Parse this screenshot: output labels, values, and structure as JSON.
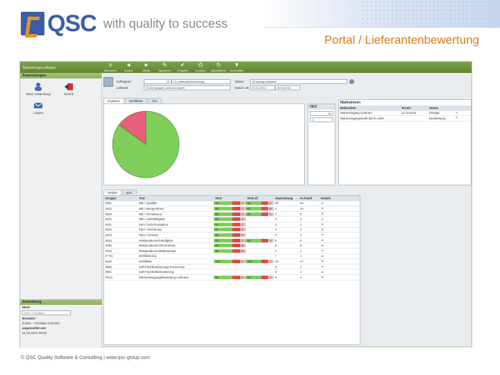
{
  "slide": {
    "logo_text": "QSC",
    "tagline": "with quality to success",
    "title": "Portal / Lieferantenbewertung",
    "footer": "© QSC Quality Software & Consulting | www.qsc-group.com"
  },
  "app": {
    "breadcrumb": "Bewertungen pflegen",
    "toolbar": [
      {
        "label": "Abbrechen",
        "icon": "x"
      },
      {
        "label": "Zurück",
        "icon": "◄"
      },
      {
        "label": "Weiter",
        "icon": "►"
      },
      {
        "label": "Speichern",
        "icon": "✎"
      },
      {
        "label": "Freigabe",
        "icon": "✔"
      },
      {
        "label": "Drucken",
        "icon": "⎙"
      },
      {
        "label": "Aktualisieren",
        "icon": "↻"
      },
      {
        "label": "Normalfilter",
        "icon": "▼"
      }
    ],
    "sidebar": {
      "header": "Anwendungen",
      "icons": [
        "Neue Anwendung",
        "Zurück",
        "Logout"
      ],
      "bottom_header": "Anmeldung",
      "werk_label": "Werk",
      "werk_value": "Werk 1 Stuttgart",
      "benutzer_label": "Benutzer",
      "benutzer_value": "Gobec - Christian Schmetz",
      "angemeldet_label": "angemeldet seit",
      "angemeldet_value": "21.10.2014 09:15"
    },
    "form": {
      "auftragsart_label": "Auftragsart",
      "auftragsart_code": "03",
      "auftragsart_value": "L5 Lieferantenbewertung",
      "status_label": "Status",
      "status_value": "30 Auftrag bewertet",
      "lieferant_label": "Lieferant",
      "lieferant_value": "20163 Beispiel Lieferant GmbH",
      "datum_label": "Datum v/b",
      "datum_von": "01.01.2014",
      "datum_bis": "30.06.2014"
    },
    "tabs": [
      "Ergebnis",
      "Zertifikate",
      "Text"
    ],
    "okz_panel": {
      "header": "OKZ",
      "value": "84",
      "grade": "C"
    },
    "massnahmen": {
      "title": "Maßnahmen",
      "headers": [
        "Maßnahme",
        "Termin",
        "Status"
      ],
      "rows": [
        {
          "text": "Wareneingang Lieferant",
          "termin": "14.10.2014",
          "status": "Erledigt"
        },
        {
          "text": "Wareneingangsaudit durch Liefer",
          "termin": "",
          "status": "Bearbeitung"
        }
      ]
    },
    "chart_data": {
      "type": "pie",
      "values": [
        85,
        15
      ],
      "colors": [
        "#7fce59",
        "#e8607a"
      ]
    },
    "grid_tabs": [
      "Details",
      "ppm"
    ],
    "grid_headers": [
      "Gruppe",
      "Text",
      "OKZ",
      "OKZ-zif",
      "Abweichung",
      "%-Anteil",
      "Details"
    ],
    "grid_rows": [
      {
        "g": "IE01",
        "t": "WE / Qualität",
        "okz": "75",
        "k": "C",
        "okzz": "62",
        "kz": "C",
        "abw": "20",
        "pct": "34"
      },
      {
        "g": "IE02",
        "t": "WE / Mengenkreuz",
        "okz": "80",
        "k": "C",
        "okzz": "63",
        "kz": "B",
        "abw": "2",
        "pct": "15"
      },
      {
        "g": "IE03",
        "t": "WE / Termintreue",
        "okz": "95",
        "k": "A",
        "okzz": "95",
        "kz": "A",
        "abw": "7",
        "pct": "3"
      },
      {
        "g": "IE3C",
        "t": "WE / Lieferfähigkeit",
        "okz": "90",
        "k": "A",
        "okzz": "",
        "kz": "",
        "abw": "2",
        "pct": "3"
      },
      {
        "g": "IE31",
        "t": "Ppm / NIO-Produktion",
        "okz": "97",
        "k": "C",
        "okzz": "",
        "kz": "",
        "abw": "1",
        "pct": "1"
      },
      {
        "g": "IE32",
        "t": "Ppm / Zeichnung",
        "okz": "97",
        "k": "C",
        "okzz": "",
        "kz": "",
        "abw": "1",
        "pct": "1"
      },
      {
        "g": "IE33",
        "t": "Ppm / Gesamt",
        "okz": "96",
        "k": "C",
        "okzz": "",
        "kz": "",
        "abw": "3",
        "pct": "1"
      },
      {
        "g": "IE34",
        "t": "Reklamationen/Häufigkeit",
        "okz": "55",
        "k": "C",
        "okzz": "55",
        "kz": "A",
        "abw": "5",
        "pct": "6"
      },
      {
        "g": "IE35",
        "t": "Reklamationen/Termintreue",
        "okz": "50",
        "k": "B",
        "okzz": "",
        "kz": "",
        "abw": "5",
        "pct": "8"
      },
      {
        "g": "IE36",
        "t": "Reklamationen/Wirksamkeit",
        "okz": "50",
        "k": "B",
        "okzz": "",
        "kz": "",
        "abw": "2",
        "pct": "1"
      },
      {
        "g": "F.701",
        "t": "Zertifizierung",
        "okz": "",
        "k": "",
        "okzz": "",
        "kz": "",
        "abw": "/",
        "pct": "1"
      },
      {
        "g": "IE40",
        "t": "Zertifikate",
        "okz": "100",
        "k": "A",
        "okzz": "100",
        "kz": "A",
        "abw": "10",
        "pct": "17"
      },
      {
        "g": "IE50",
        "t": "Soft-Fact/Erweiterungs Know-How",
        "okz": "",
        "k": "",
        "okzz": "",
        "kz": "",
        "abw": "3",
        "pct": "1"
      },
      {
        "g": "IE51",
        "t": "Soft-Fact/Entbemusterung",
        "okz": "",
        "k": "",
        "okzz": "",
        "kz": "",
        "abw": "3",
        "pct": "1"
      },
      {
        "g": "PK11",
        "t": "Sammelwegungsbewertung Lieferant",
        "okz": "90",
        "k": "C",
        "okzz": "53",
        "kz": "A",
        "abw": "5",
        "pct": "1"
      }
    ]
  }
}
